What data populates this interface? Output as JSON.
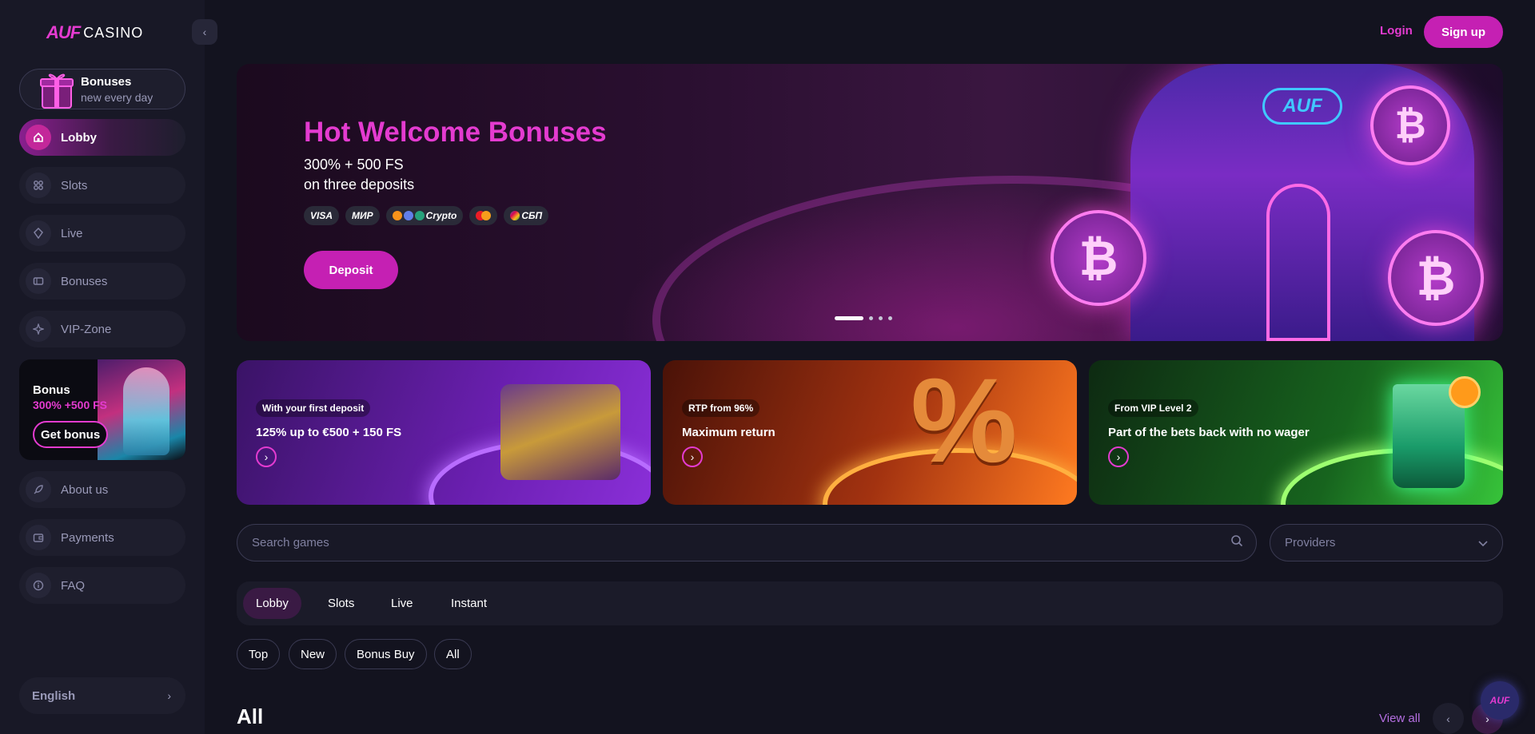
{
  "brand": {
    "logo_mark": "AUF",
    "logo_text": "CASINO"
  },
  "sidebar": {
    "promo": {
      "title": "Bonuses",
      "subtitle": "new every day"
    },
    "items": [
      {
        "label": "Lobby",
        "icon": "home-icon"
      },
      {
        "label": "Slots",
        "icon": "grid-icon"
      },
      {
        "label": "Live",
        "icon": "live-icon"
      },
      {
        "label": "Bonuses",
        "icon": "ticket-icon"
      },
      {
        "label": "VIP-Zone",
        "icon": "vip-icon"
      },
      {
        "label": "About us",
        "icon": "rocket-icon"
      },
      {
        "label": "Payments",
        "icon": "wallet-icon"
      },
      {
        "label": "FAQ",
        "icon": "info-icon"
      }
    ],
    "bonus_card": {
      "title": "Bonus",
      "amount": "300% +500 FS",
      "button": "Get bonus"
    },
    "language": "English"
  },
  "header": {
    "login": "Login",
    "signup": "Sign up"
  },
  "hero": {
    "title": "Hot Welcome Bonuses",
    "line1": "300% + 500 FS",
    "line2": "on three deposits",
    "payments": [
      "VISA",
      "МИР",
      "Crypto",
      "Mastercard",
      "СБП"
    ],
    "deposit_button": "Deposit",
    "slide_count": 4,
    "active_slide": 1
  },
  "promo_cards": [
    {
      "tag": "With your first deposit",
      "title": "125% up to €500 + 150 FS"
    },
    {
      "tag": "RTP from 96%",
      "title": "Maximum return"
    },
    {
      "tag": "From VIP Level 2",
      "title": "Part of the bets back with no wager"
    }
  ],
  "search": {
    "placeholder": "Search games"
  },
  "providers": {
    "label": "Providers"
  },
  "tabs": [
    "Lobby",
    "Slots",
    "Live",
    "Instant"
  ],
  "filters": [
    "Top",
    "New",
    "Bonus Buy",
    "All"
  ],
  "section": {
    "title": "All",
    "view_all": "View all"
  },
  "colors": {
    "accent": "#e43bd0",
    "button": "#c520b3",
    "background": "#13131f",
    "sidebar": "#181826"
  }
}
